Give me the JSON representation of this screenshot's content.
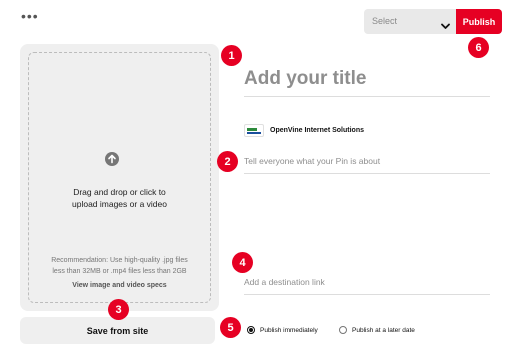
{
  "toolbar": {
    "more_label": "•••",
    "board_select_value": "Select",
    "publish_label": "Publish"
  },
  "upload": {
    "prompt_line1": "Drag and drop or click to",
    "prompt_line2": "upload images or a video",
    "rec_line1": "Recommendation: Use high-quality .jpg files",
    "rec_line2": "less than 32MB or .mp4 files less than 2GB",
    "specs_link": "View image and video specs",
    "save_from_site": "Save from site"
  },
  "pin": {
    "title_placeholder": "Add your title",
    "account_name": "OpenVine Internet Solutions",
    "description_placeholder": "Tell everyone what your Pin is about",
    "link_placeholder": "Add a destination link"
  },
  "publish_options": {
    "immediately": "Publish immediately",
    "later": "Publish at a later date",
    "selected": "immediately"
  },
  "markers": [
    "1",
    "2",
    "3",
    "4",
    "5",
    "6"
  ],
  "colors": {
    "accent": "#e60023",
    "panel": "#efefef",
    "placeholder": "#8e8e8e"
  },
  "icons": {
    "more": "more-horizontal-icon",
    "chevron": "chevron-down-icon",
    "upload": "upload-arrow-icon"
  }
}
